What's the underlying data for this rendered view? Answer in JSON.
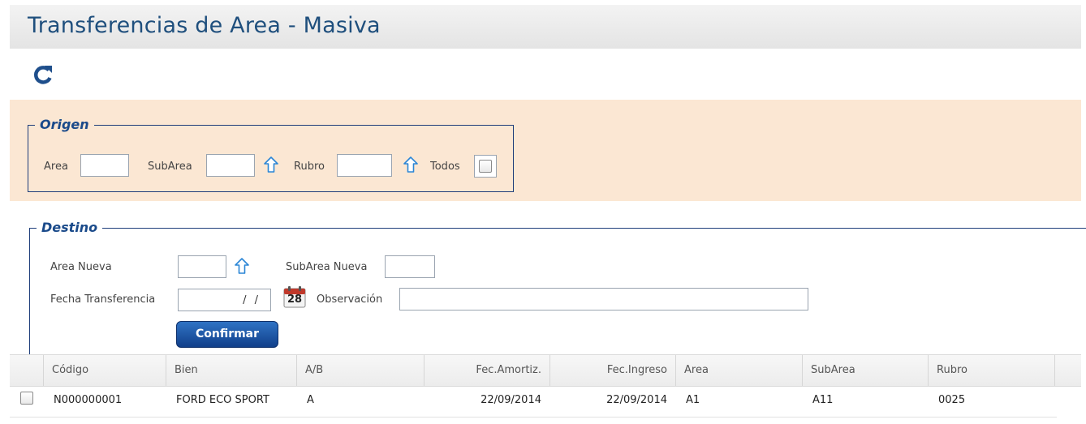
{
  "page": {
    "title": "Transferencias de Area - Masiva"
  },
  "toolbar": {
    "refresh_icon": "refresh-icon"
  },
  "origen": {
    "legend": "Origen",
    "area_label": "Area",
    "area_value": "",
    "subarea_label": "SubArea",
    "subarea_value": "",
    "rubro_label": "Rubro",
    "rubro_value": "",
    "todos_label": "Todos",
    "todos_checked": false
  },
  "destino": {
    "legend": "Destino",
    "area_nueva_label": "Area Nueva",
    "area_nueva_value": "",
    "subarea_nueva_label": "SubArea Nueva",
    "subarea_nueva_value": "",
    "fecha_label": "Fecha Transferencia",
    "fecha_value": "/ /",
    "calendar_day": "28",
    "observacion_label": "Observación",
    "observacion_value": "",
    "confirm_label": "Confirmar"
  },
  "grid": {
    "columns": [
      "Código",
      "Bien",
      "A/B",
      "Fec.Amortiz.",
      "Fec.Ingreso",
      "Area",
      "SubArea",
      "Rubro"
    ],
    "rows": [
      {
        "checked": false,
        "codigo": "N000000001",
        "bien": "FORD ECO SPORT",
        "ab": "A",
        "fec_amortiz": "22/09/2014",
        "fec_ingreso": "22/09/2014",
        "area": "A1",
        "subarea": "A11",
        "rubro": "0025"
      }
    ]
  },
  "colors": {
    "title": "#1f4f7d",
    "accent": "#1a4a8a",
    "origen_background": "#fbe7d3",
    "button": "#1a54a8"
  }
}
